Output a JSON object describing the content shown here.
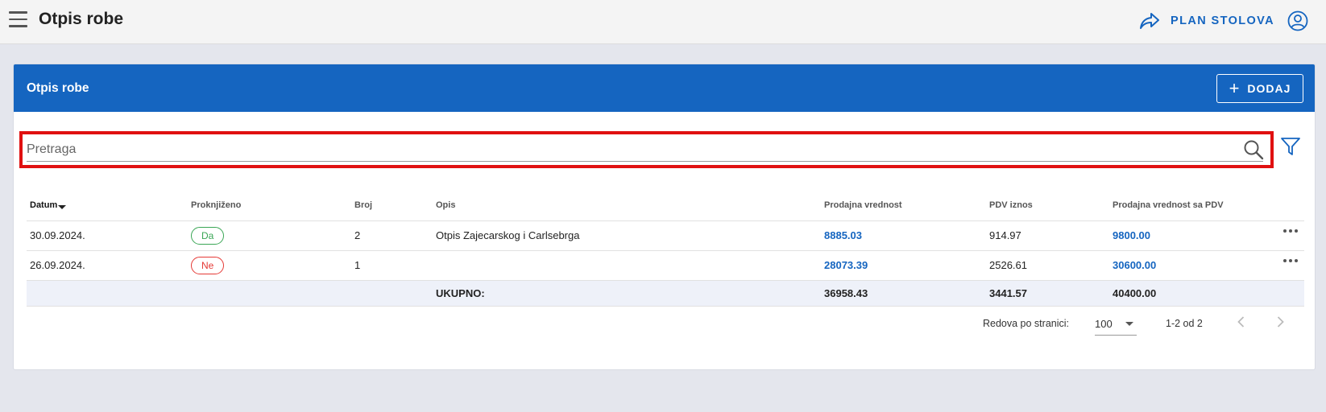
{
  "header": {
    "title": "Otpis robe",
    "plan_link": "PLAN STOLOVA"
  },
  "card": {
    "title": "Otpis robe",
    "add_label": "DODAJ"
  },
  "search": {
    "placeholder": "Pretraga",
    "value": ""
  },
  "table": {
    "columns": [
      "Datum",
      "Proknjiženo",
      "Broj",
      "Opis",
      "Prodajna vrednost",
      "PDV iznos",
      "Prodajna vrednost sa PDV"
    ],
    "sort_column": "Datum",
    "rows": [
      {
        "datum": "30.09.2024.",
        "proknjizeno": "Da",
        "broj": "2",
        "opis": "Otpis Zajecarskog i Carlsebrga",
        "prodajna": "8885.03",
        "pdv": "914.97",
        "sa_pdv": "9800.00"
      },
      {
        "datum": "26.09.2024.",
        "proknjizeno": "Ne",
        "broj": "1",
        "opis": "",
        "prodajna": "28073.39",
        "pdv": "2526.61",
        "sa_pdv": "30600.00"
      }
    ],
    "total": {
      "label": "UKUPNO:",
      "prodajna": "36958.43",
      "pdv": "3441.57",
      "sa_pdv": "40400.00"
    }
  },
  "pagination": {
    "rows_label": "Redova po stranici:",
    "rows_value": "100",
    "range": "1-2 od 2"
  },
  "colors": {
    "primary": "#1565c0",
    "highlight": "#e01010",
    "yes": "#3aa655",
    "no": "#e53935"
  }
}
